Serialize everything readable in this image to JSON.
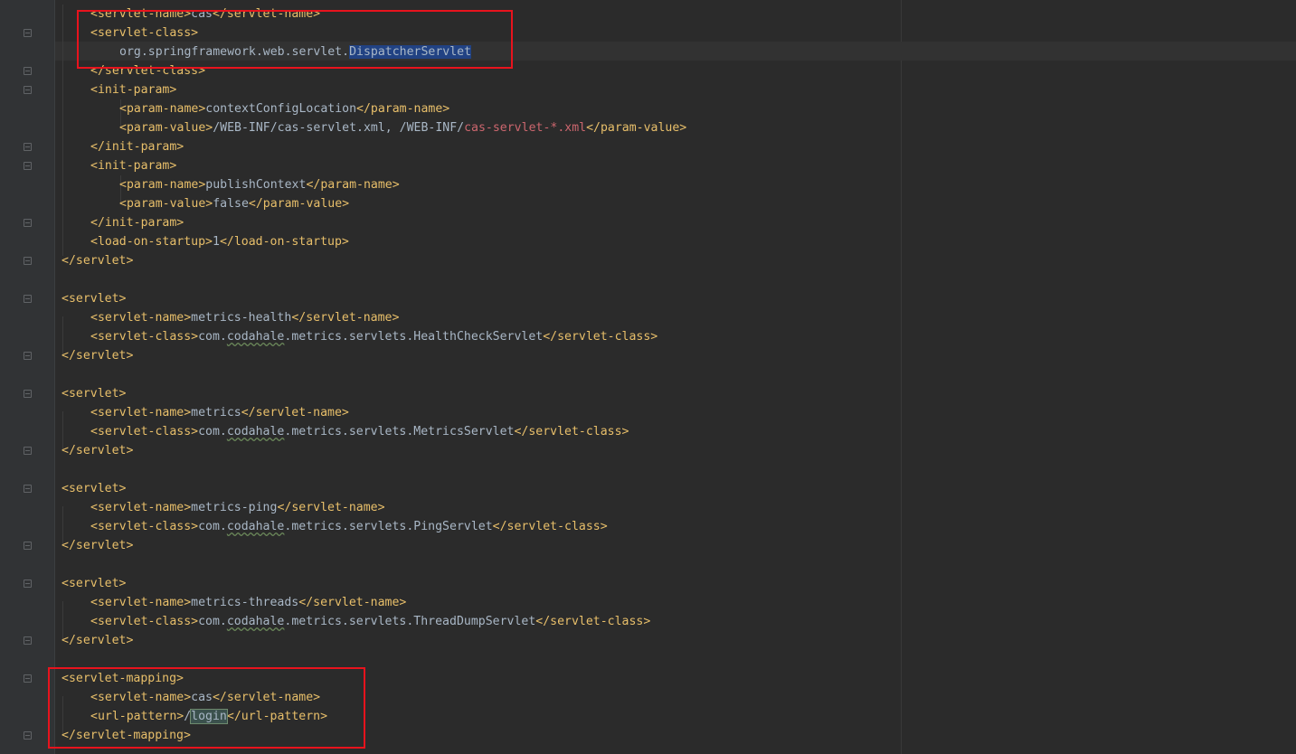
{
  "editor": {
    "lines": [
      [
        {
          "c": "tag",
          "t": "<servlet-name>"
        },
        {
          "c": "txt",
          "t": "cas"
        },
        {
          "c": "tag",
          "t": "</servlet-name>"
        }
      ],
      [
        {
          "c": "tag",
          "t": "<servlet-class>"
        }
      ],
      [
        {
          "c": "txt",
          "t": "org.springframework.web.servlet."
        },
        {
          "c": "sel",
          "t": "DispatcherServlet"
        }
      ],
      [
        {
          "c": "tag",
          "t": "</servlet-class>"
        }
      ],
      [
        {
          "c": "tag",
          "t": "<init-param>"
        }
      ],
      [
        {
          "c": "tag",
          "t": "<param-name>"
        },
        {
          "c": "txt",
          "t": "contextConfigLocation"
        },
        {
          "c": "tag",
          "t": "</param-name>"
        }
      ],
      [
        {
          "c": "tag",
          "t": "<param-value>"
        },
        {
          "c": "txt",
          "t": "/WEB-INF/cas-servlet.xml, /WEB-INF/"
        },
        {
          "c": "err",
          "t": "cas-servlet-*.xml"
        },
        {
          "c": "tag",
          "t": "</param-value>"
        }
      ],
      [
        {
          "c": "tag",
          "t": "</init-param>"
        }
      ],
      [
        {
          "c": "tag",
          "t": "<init-param>"
        }
      ],
      [
        {
          "c": "tag",
          "t": "<param-name>"
        },
        {
          "c": "txt",
          "t": "publishContext"
        },
        {
          "c": "tag",
          "t": "</param-name>"
        }
      ],
      [
        {
          "c": "tag",
          "t": "<param-value>"
        },
        {
          "c": "txt",
          "t": "false"
        },
        {
          "c": "tag",
          "t": "</param-value>"
        }
      ],
      [
        {
          "c": "tag",
          "t": "</init-param>"
        }
      ],
      [
        {
          "c": "tag",
          "t": "<load-on-startup>"
        },
        {
          "c": "txt",
          "t": "1"
        },
        {
          "c": "tag",
          "t": "</load-on-startup>"
        }
      ],
      [
        {
          "c": "tag",
          "t": "</servlet>"
        }
      ],
      [],
      [
        {
          "c": "tag",
          "t": "<servlet>"
        }
      ],
      [
        {
          "c": "tag",
          "t": "<servlet-name>"
        },
        {
          "c": "txt",
          "t": "metrics-health"
        },
        {
          "c": "tag",
          "t": "</servlet-name>"
        }
      ],
      [
        {
          "c": "tag",
          "t": "<servlet-class>"
        },
        {
          "c": "txt",
          "t": "com."
        },
        {
          "c": "wavy",
          "t": "codahale"
        },
        {
          "c": "txt",
          "t": ".metrics.servlets.HealthCheckServlet"
        },
        {
          "c": "tag",
          "t": "</servlet-class>"
        }
      ],
      [
        {
          "c": "tag",
          "t": "</servlet>"
        }
      ],
      [],
      [
        {
          "c": "tag",
          "t": "<servlet>"
        }
      ],
      [
        {
          "c": "tag",
          "t": "<servlet-name>"
        },
        {
          "c": "txt",
          "t": "metrics"
        },
        {
          "c": "tag",
          "t": "</servlet-name>"
        }
      ],
      [
        {
          "c": "tag",
          "t": "<servlet-class>"
        },
        {
          "c": "txt",
          "t": "com."
        },
        {
          "c": "wavy",
          "t": "codahale"
        },
        {
          "c": "txt",
          "t": ".metrics.servlets.MetricsServlet"
        },
        {
          "c": "tag",
          "t": "</servlet-class>"
        }
      ],
      [
        {
          "c": "tag",
          "t": "</servlet>"
        }
      ],
      [],
      [
        {
          "c": "tag",
          "t": "<servlet>"
        }
      ],
      [
        {
          "c": "tag",
          "t": "<servlet-name>"
        },
        {
          "c": "txt",
          "t": "metrics-ping"
        },
        {
          "c": "tag",
          "t": "</servlet-name>"
        }
      ],
      [
        {
          "c": "tag",
          "t": "<servlet-class>"
        },
        {
          "c": "txt",
          "t": "com."
        },
        {
          "c": "wavy",
          "t": "codahale"
        },
        {
          "c": "txt",
          "t": ".metrics.servlets.PingServlet"
        },
        {
          "c": "tag",
          "t": "</servlet-class>"
        }
      ],
      [
        {
          "c": "tag",
          "t": "</servlet>"
        }
      ],
      [],
      [
        {
          "c": "tag",
          "t": "<servlet>"
        }
      ],
      [
        {
          "c": "tag",
          "t": "<servlet-name>"
        },
        {
          "c": "txt",
          "t": "metrics-threads"
        },
        {
          "c": "tag",
          "t": "</servlet-name>"
        }
      ],
      [
        {
          "c": "tag",
          "t": "<servlet-class>"
        },
        {
          "c": "txt",
          "t": "com."
        },
        {
          "c": "wavy",
          "t": "codahale"
        },
        {
          "c": "txt",
          "t": ".metrics.servlets.ThreadDumpServlet"
        },
        {
          "c": "tag",
          "t": "</servlet-class>"
        }
      ],
      [
        {
          "c": "tag",
          "t": "</servlet>"
        }
      ],
      [],
      [
        {
          "c": "tag",
          "t": "<servlet-mapping>"
        }
      ],
      [
        {
          "c": "tag",
          "t": "<servlet-name>"
        },
        {
          "c": "txt",
          "t": "cas"
        },
        {
          "c": "tag",
          "t": "</servlet-name>"
        }
      ],
      [
        {
          "c": "tag",
          "t": "<url-pattern>"
        },
        {
          "c": "txt",
          "t": "/"
        },
        {
          "c": "hl",
          "t": "login"
        },
        {
          "c": "tag",
          "t": "</url-pattern>"
        }
      ],
      [
        {
          "c": "tag",
          "t": "</servlet-mapping>"
        }
      ]
    ]
  },
  "colors": {
    "tag": "#e8bf6a",
    "text": "#a9b7c6",
    "error_path": "#cc666e",
    "selection": "#214283",
    "highlight_box": "#e8131d",
    "background": "#2b2b2b"
  }
}
